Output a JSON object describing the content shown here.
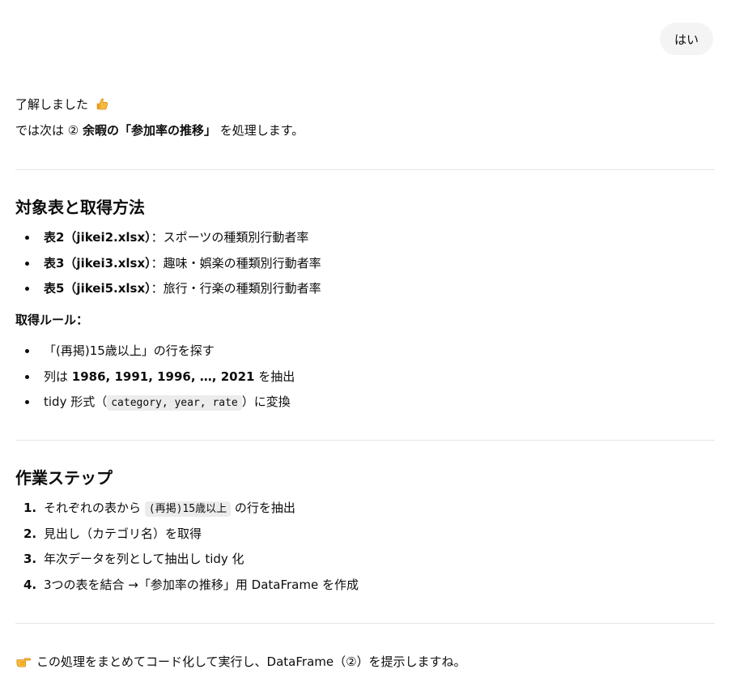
{
  "user_message": "はい",
  "response": {
    "line1": "了解しました",
    "line1_emoji": "thumbs-up-icon",
    "line2": {
      "prefix": "では次は ② ",
      "bold": "余暇の「参加率の推移」",
      "suffix": " を処理します。"
    },
    "section1": {
      "heading": "対象表と取得方法",
      "items": [
        {
          "bold": "表2（jikei2.xlsx）",
          "text": "：スポーツの種類別行動者率"
        },
        {
          "bold": "表3（jikei3.xlsx）",
          "text": "：趣味・娯楽の種類別行動者率"
        },
        {
          "bold": "表5（jikei5.xlsx）",
          "text": "：旅行・行楽の種類別行動者率"
        }
      ],
      "rule_heading": "取得ルール：",
      "rules": {
        "r1": "「(再掲)15歳以上」の行を探す",
        "r2_prefix": "列は ",
        "r2_bold": "1986, 1991, 1996, …, 2021",
        "r2_suffix": " を抽出",
        "r3_prefix": "tidy 形式（",
        "r3_code": "category, year, rate",
        "r3_suffix": "）に変換"
      }
    },
    "section2": {
      "heading": "作業ステップ",
      "steps": [
        {
          "num": "1.",
          "prefix": "それぞれの表から ",
          "code": "(再掲)15歳以上",
          "suffix": " の行を抽出"
        },
        {
          "num": "2.",
          "text": "見出し（カテゴリ名）を取得"
        },
        {
          "num": "3.",
          "text": "年次データを列として抽出し tidy 化"
        },
        {
          "num": "4.",
          "text": "3つの表を結合 →「参加率の推移」用 DataFrame を作成"
        }
      ]
    },
    "closing": "この処理をまとめてコード化して実行し、DataFrame（②）を提示しますね。",
    "closing_emoji": "pointing-hand-icon"
  }
}
